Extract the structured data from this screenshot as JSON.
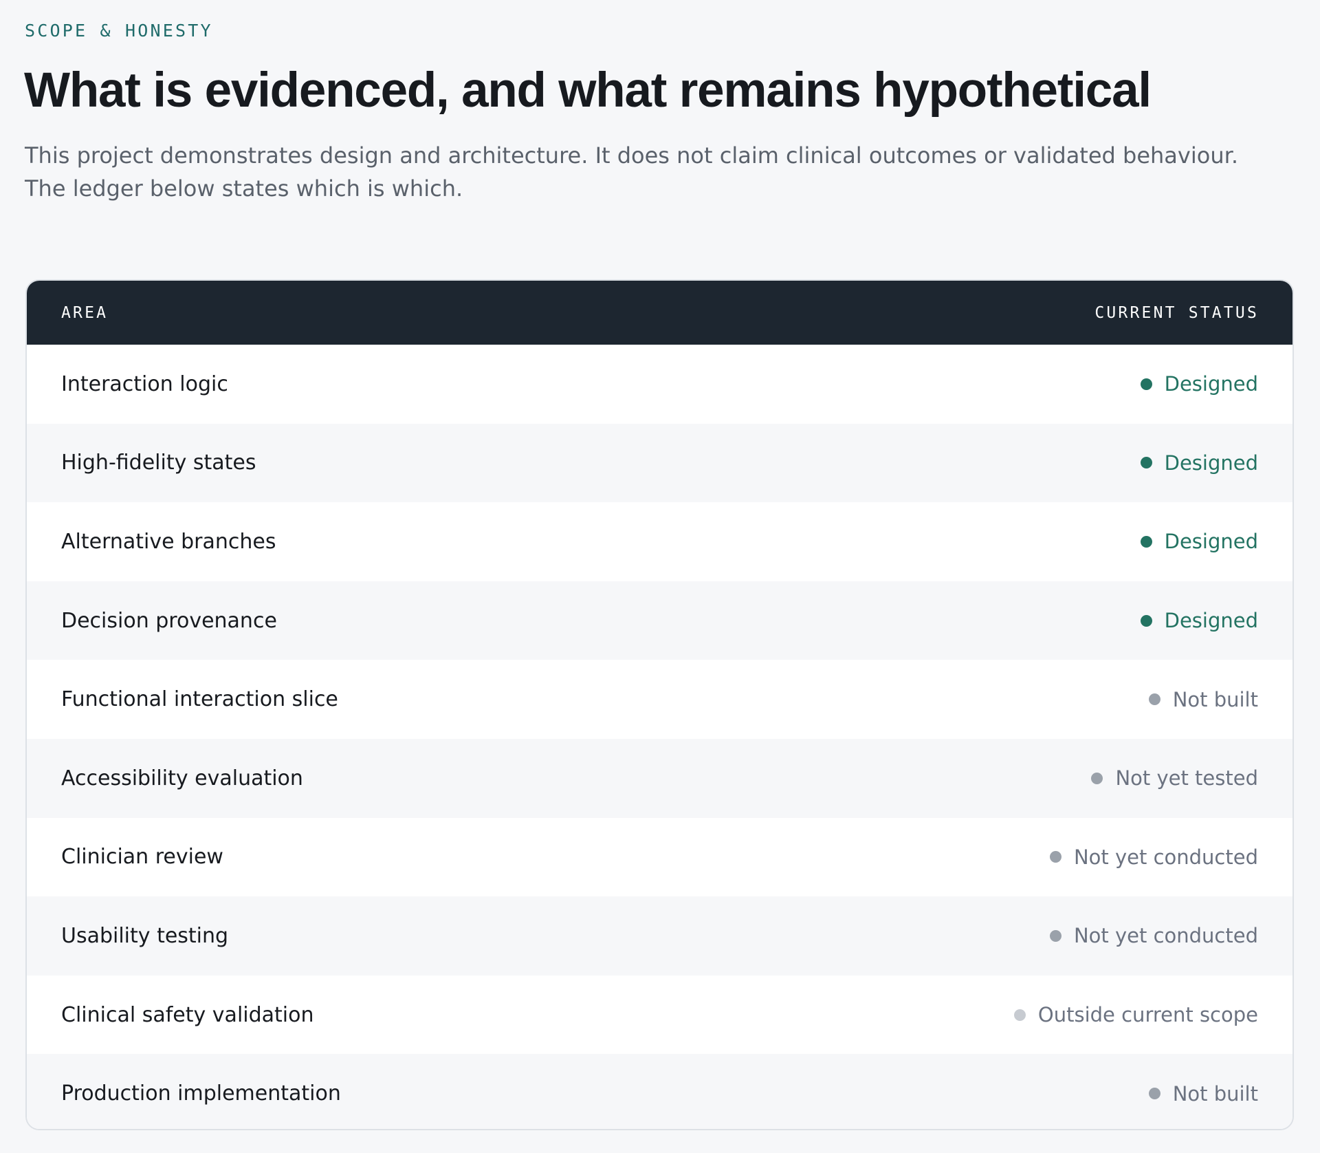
{
  "section": {
    "eyebrow": "SCOPE & HONESTY",
    "title": "What is evidenced, and what remains hypothetical",
    "subtitle": "This project demonstrates design and architecture. It does not claim clinical outcomes or validated behaviour. The ledger below states which is which."
  },
  "ledger": {
    "header_area": "AREA",
    "header_status": "CURRENT STATUS",
    "rows": [
      {
        "area": "Interaction logic",
        "status": "Designed",
        "status_color": "#237362",
        "dot_color": "#237362"
      },
      {
        "area": "High-fidelity states",
        "status": "Designed",
        "status_color": "#237362",
        "dot_color": "#237362"
      },
      {
        "area": "Alternative branches",
        "status": "Designed",
        "status_color": "#237362",
        "dot_color": "#237362"
      },
      {
        "area": "Decision provenance",
        "status": "Designed",
        "status_color": "#237362",
        "dot_color": "#237362"
      },
      {
        "area": "Functional interaction slice",
        "status": "Not built",
        "status_color": "#6b7280",
        "dot_color": "#9aa1aa"
      },
      {
        "area": "Accessibility evaluation",
        "status": "Not yet tested",
        "status_color": "#6b7280",
        "dot_color": "#9aa1aa"
      },
      {
        "area": "Clinician review",
        "status": "Not yet conducted",
        "status_color": "#6b7280",
        "dot_color": "#9aa1aa"
      },
      {
        "area": "Usability testing",
        "status": "Not yet conducted",
        "status_color": "#6b7280",
        "dot_color": "#9aa1aa"
      },
      {
        "area": "Clinical safety validation",
        "status": "Outside current scope",
        "status_color": "#6b7280",
        "dot_color": "#c7cbd1"
      },
      {
        "area": "Production implementation",
        "status": "Not built",
        "status_color": "#6b7280",
        "dot_color": "#9aa1aa"
      }
    ]
  }
}
